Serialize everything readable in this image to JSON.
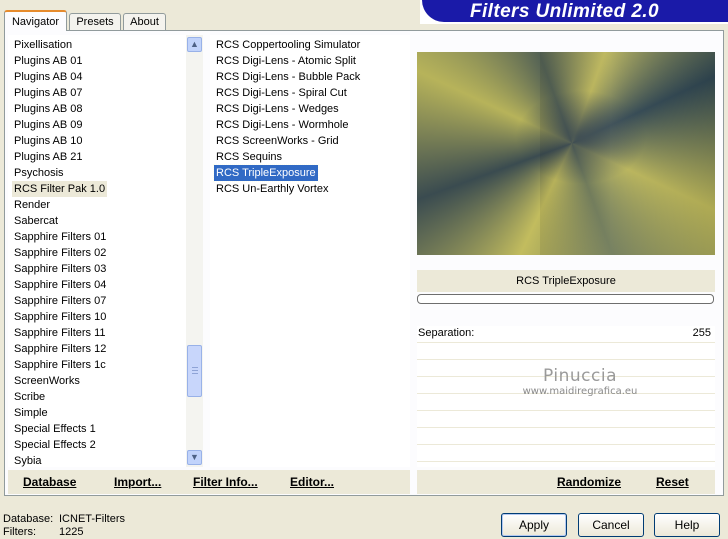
{
  "window": {
    "title": "Filters Unlimited 2.0"
  },
  "tabs": [
    {
      "label": "Navigator",
      "active": true
    },
    {
      "label": "Presets",
      "active": false
    },
    {
      "label": "About",
      "active": false
    }
  ],
  "categories": {
    "items": [
      "Pixellisation",
      "Plugins AB 01",
      "Plugins AB 04",
      "Plugins AB 07",
      "Plugins AB 08",
      "Plugins AB 09",
      "Plugins AB 10",
      "Plugins AB 21",
      "Psychosis",
      "RCS Filter Pak 1.0",
      "Render",
      "Sabercat",
      "Sapphire Filters 01",
      "Sapphire Filters 02",
      "Sapphire Filters 03",
      "Sapphire Filters 04",
      "Sapphire Filters 07",
      "Sapphire Filters 10",
      "Sapphire Filters 11",
      "Sapphire Filters 12",
      "Sapphire Filters 1c",
      "ScreenWorks",
      "Scribe",
      "Simple",
      "Special Effects 1",
      "Special Effects 2",
      "Sybia"
    ],
    "selected": "RCS Filter Pak 1.0"
  },
  "filters": {
    "items": [
      "RCS Coppertooling Simulator",
      "RCS Digi-Lens - Atomic Split",
      "RCS Digi-Lens - Bubble Pack",
      "RCS Digi-Lens - Spiral Cut",
      "RCS Digi-Lens - Wedges",
      "RCS Digi-Lens - Wormhole",
      "RCS ScreenWorks - Grid",
      "RCS Sequins",
      "RCS TripleExposure",
      "RCS Un-Earthly Vortex"
    ],
    "selected": "RCS TripleExposure"
  },
  "preview": {
    "filter_name": "RCS TripleExposure",
    "progress": 0
  },
  "parameters": [
    {
      "label": "Separation:",
      "value": "255"
    }
  ],
  "watermark": {
    "name": "Pinuccia",
    "url": "www.maidiregrafica.eu"
  },
  "left_links": {
    "database": "Database",
    "import": "Import...",
    "filter_info": "Filter Info...",
    "editor": "Editor..."
  },
  "right_links": {
    "randomize": "Randomize",
    "reset": "Reset"
  },
  "footer": {
    "database_label": "Database:",
    "database_value": "ICNET-Filters",
    "filters_label": "Filters:",
    "filters_value": "1225"
  },
  "buttons": {
    "apply": "Apply",
    "cancel": "Cancel",
    "help": "Help"
  },
  "colors": {
    "banner": "#1a1aa8",
    "selection": "#316ac5",
    "tab_accent": "#e68b2c"
  },
  "icons": {
    "scroll_up": "chevron-up-icon",
    "scroll_down": "chevron-down-icon"
  }
}
